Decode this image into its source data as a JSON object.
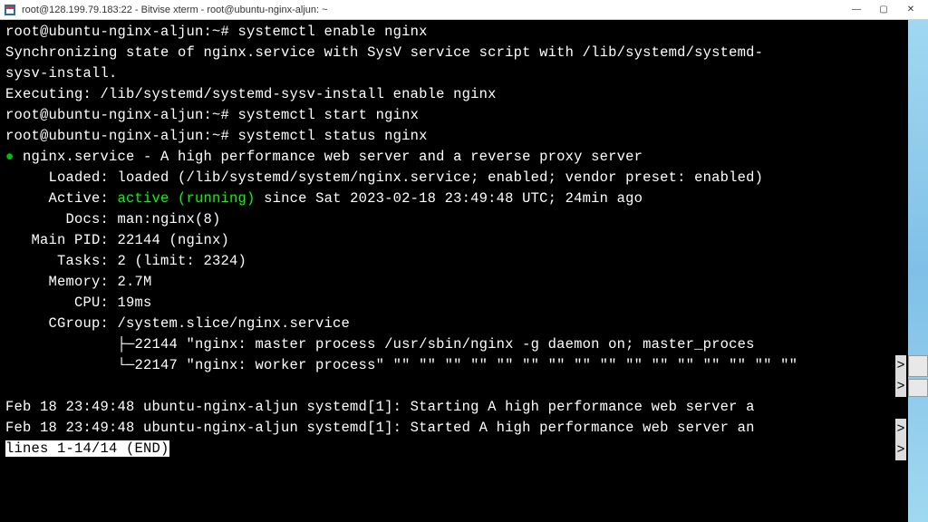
{
  "window": {
    "title": "root@128.199.79.183:22 - Bitvise xterm - root@ubuntu-nginx-aljun: ~",
    "minimize": "—",
    "maximize": "▢",
    "close": "✕"
  },
  "prompt": "root@ubuntu-nginx-aljun:~# ",
  "commands": {
    "enable": "systemctl enable nginx",
    "start": "systemctl start nginx",
    "status": "systemctl status nginx"
  },
  "sync_line1": "Synchronizing state of nginx.service with SysV service script with /lib/systemd/systemd-",
  "sync_line2": "sysv-install.",
  "executing": "Executing: /lib/systemd/systemd-sysv-install enable nginx",
  "bullet": "●",
  "service_title": " nginx.service - A high performance web server and a reverse proxy server",
  "loaded": "     Loaded: loaded (/lib/systemd/system/nginx.service; enabled; vendor preset: enabled)",
  "active_prefix": "     Active: ",
  "active_state": "active (running)",
  "active_suffix": " since Sat 2023-02-18 23:49:48 UTC; 24min ago",
  "docs": "       Docs: man:nginx(8)",
  "mainpid": "   Main PID: 22144 (nginx)",
  "tasks": "      Tasks: 2 (limit: 2324)",
  "memory": "     Memory: 2.7M",
  "cpu": "        CPU: 19ms",
  "cgroup": "     CGroup: /system.slice/nginx.service",
  "proc1": "             ├─22144 \"nginx: master process /usr/sbin/nginx -g daemon on; master_proces",
  "proc2": "             └─22147 \"nginx: worker process\" \"\" \"\" \"\" \"\" \"\" \"\" \"\" \"\" \"\" \"\" \"\" \"\" \"\" \"\" \"\" \"\"",
  "blank": "",
  "log1": "Feb 18 23:49:48 ubuntu-nginx-aljun systemd[1]: Starting A high performance web server a",
  "log2": "Feb 18 23:49:48 ubuntu-nginx-aljun systemd[1]: Started A high performance web server an",
  "pager": "lines 1-14/14 (END)",
  "overflow": ">"
}
